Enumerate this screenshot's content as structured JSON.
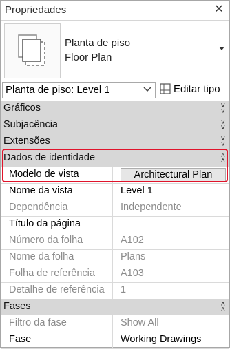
{
  "window": {
    "title": "Propriedades",
    "close_symbol": "✕"
  },
  "type_selector": {
    "line1": "Planta de piso",
    "line2": "Floor Plan",
    "thumbnail_icon": "floor-plan-view-icon",
    "expand_icon": "chevron-down-icon"
  },
  "instance_selector": {
    "value": "Planta de piso: Level 1",
    "edit_type_label": "Editar tipo"
  },
  "sections": {
    "graficos": "Gráficos",
    "subjacencia": "Subjacência",
    "extensoes": "Extensões",
    "identidade": "Dados de identidade",
    "fases": "Fases"
  },
  "identity_rows": [
    {
      "name": "Modelo de vista",
      "value": "Architectural Plan"
    },
    {
      "name": "Nome da vista",
      "value": "Level 1"
    },
    {
      "name": "Dependência",
      "value": "Independente"
    },
    {
      "name": "Título da página",
      "value": ""
    },
    {
      "name": "Número da folha",
      "value": "A102"
    },
    {
      "name": "Nome da folha",
      "value": "Plans"
    },
    {
      "name": "Folha de referência",
      "value": "A103"
    },
    {
      "name": "Detalhe de referência",
      "value": "1"
    }
  ],
  "phase_rows": [
    {
      "name": "Filtro da fase",
      "value": "Show All"
    },
    {
      "name": "Fase",
      "value": "Working Drawings"
    }
  ],
  "colors": {
    "highlight": "#e0142b",
    "section_bg": "#d7d7d7",
    "disabled_text": "#8c8c8c"
  }
}
